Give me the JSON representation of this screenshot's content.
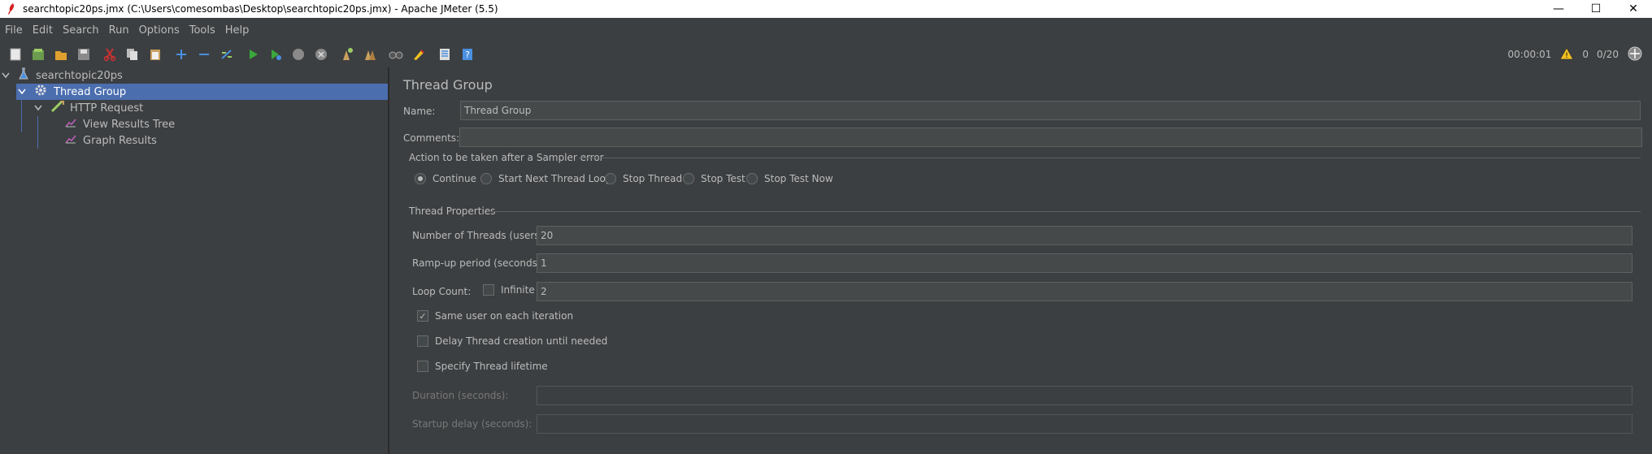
{
  "window": {
    "title": "searchtopic20ps.jmx (C:\\Users\\comesombas\\Desktop\\searchtopic20ps.jmx) - Apache JMeter (5.5)",
    "minimize": "—",
    "maximize": "☐",
    "close": "✕"
  },
  "menu": [
    {
      "label": "File"
    },
    {
      "label": "Edit"
    },
    {
      "label": "Search"
    },
    {
      "label": "Run"
    },
    {
      "label": "Options"
    },
    {
      "label": "Tools"
    },
    {
      "label": "Help"
    }
  ],
  "toolbar": {
    "icons": [
      "new-icon",
      "templates-icon",
      "open-icon",
      "save-icon",
      "cut-icon",
      "copy-icon",
      "paste-icon",
      "expand-icon",
      "collapse-icon",
      "toggle-icon",
      "start-icon",
      "start-no-pause-icon",
      "stop-icon",
      "shutdown-icon",
      "clear-icon",
      "clear-all-icon",
      "search-icon",
      "reset-search-icon",
      "function-helper-icon",
      "help-icon"
    ],
    "timer": "00:00:01",
    "warning_count": "0",
    "threads": "0/20"
  },
  "tree": {
    "items": [
      {
        "label": "searchtopic20ps",
        "icon": "test-plan-icon"
      },
      {
        "label": "Thread Group",
        "icon": "gear-icon"
      },
      {
        "label": "HTTP Request",
        "icon": "pipette-icon"
      },
      {
        "label": "View Results Tree",
        "icon": "chart-icon"
      },
      {
        "label": "Graph Results",
        "icon": "chart-icon"
      }
    ]
  },
  "panel": {
    "title": "Thread Group",
    "name_label": "Name:",
    "name_value": "Thread Group",
    "comments_label": "Comments:",
    "comments_value": "",
    "sampler_error_title": "Action to be taken after a Sampler error",
    "sampler_error_options": [
      "Continue",
      "Start Next Thread Loop",
      "Stop Thread",
      "Stop Test",
      "Stop Test Now"
    ],
    "sampler_error_selected": "Continue",
    "thread_props_title": "Thread Properties",
    "threads_label": "Number of Threads (users):",
    "threads_value": "20",
    "rampup_label": "Ramp-up period (seconds):",
    "rampup_value": "1",
    "loop_label": "Loop Count:",
    "infinite_label": "Infinite",
    "infinite_checked": false,
    "loop_value": "2",
    "same_user_label": "Same user on each iteration",
    "same_user_checked": true,
    "delay_label": "Delay Thread creation until needed",
    "delay_checked": false,
    "lifetime_label": "Specify Thread lifetime",
    "lifetime_checked": false,
    "duration_label": "Duration (seconds):",
    "duration_value": "",
    "startup_label": "Startup delay (seconds):",
    "startup_value": ""
  },
  "colors": {
    "background": "#3c3f41",
    "selection": "#4b6eaf",
    "text": "#bbbbbb",
    "field": "#45494a"
  }
}
